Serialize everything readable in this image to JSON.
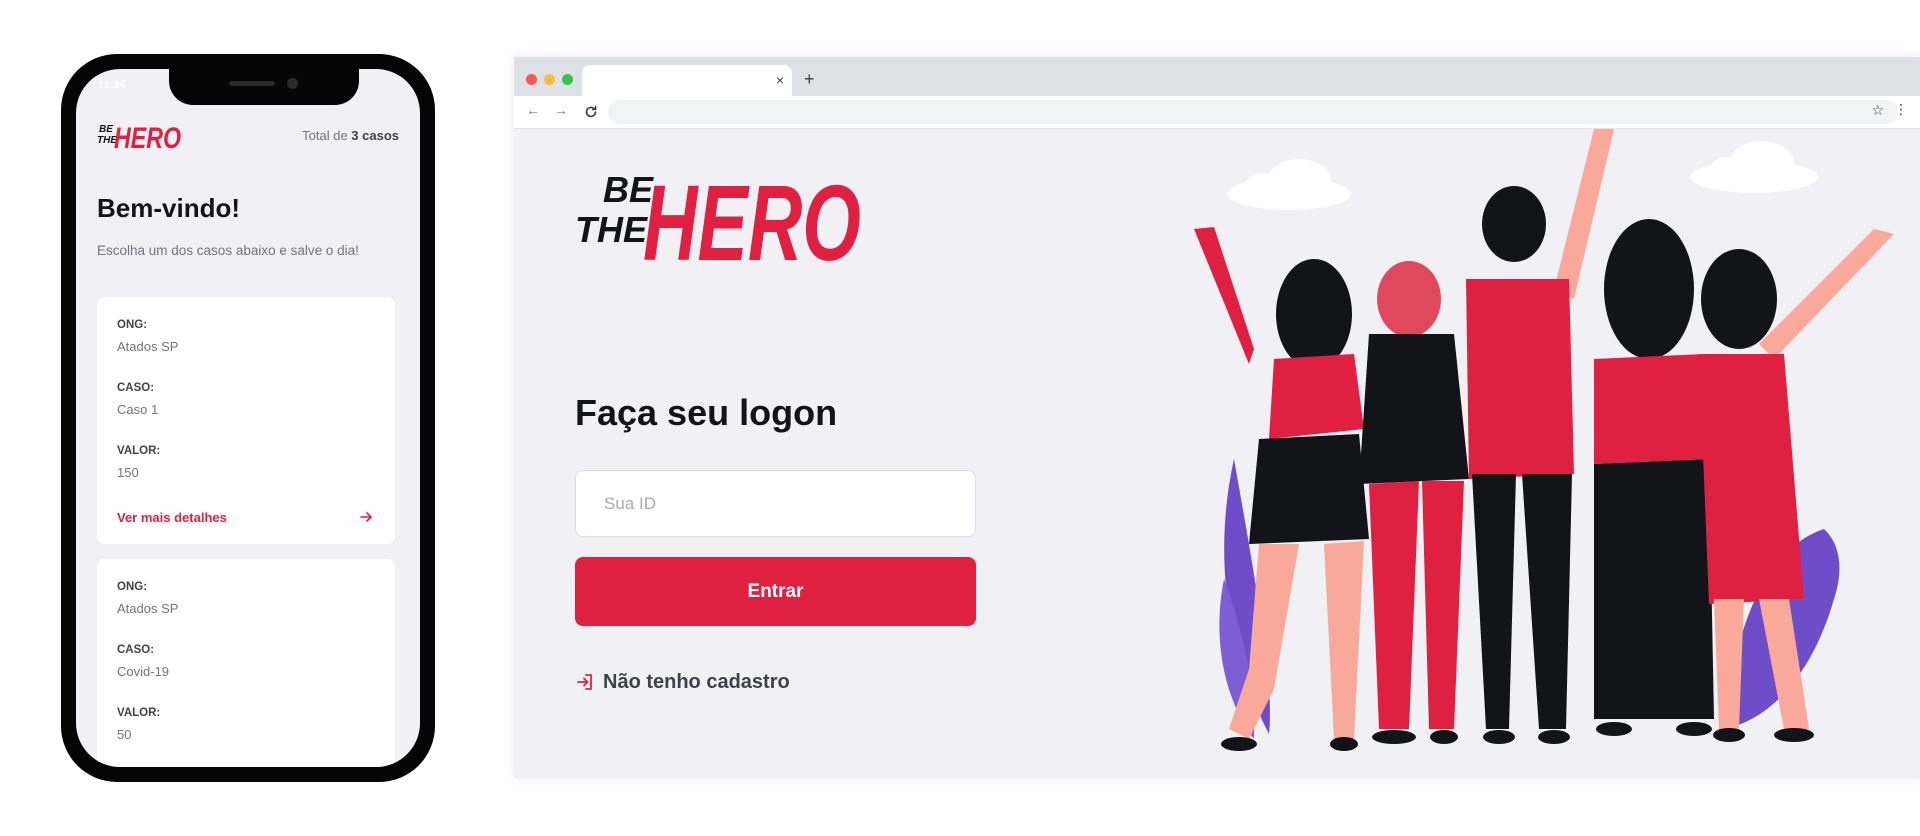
{
  "colors": {
    "brand_red": "#e02041",
    "background": "#f0f0f5",
    "dark_text": "#13131a",
    "muted_text": "#737380",
    "purple": "#6f4dc9"
  },
  "logo": {
    "line1": "BE",
    "line2": "THE",
    "word": "HERO"
  },
  "mobile": {
    "status_time": "11:34",
    "total_prefix": "Total de ",
    "total_count": "3 casos",
    "title": "Bem-vindo!",
    "subtitle": "Escolha um dos casos abaixo e salve o dia!",
    "labels": {
      "ong": "ONG:",
      "caso": "CASO:",
      "valor": "VALOR:"
    },
    "link_label": "Ver mais detalhes",
    "cases": [
      {
        "ong": "Atados SP",
        "caso": "Caso 1",
        "valor": "150"
      },
      {
        "ong": "Atados SP",
        "caso": "Covid-19",
        "valor": "50"
      }
    ]
  },
  "browser": {
    "tab_title": "",
    "tab_close": "×",
    "new_tab": "+",
    "nav": {
      "back": "←",
      "forward": "→",
      "reload": "C",
      "star": "☆",
      "menu": "⋮"
    },
    "url": ""
  },
  "login": {
    "title": "Faça seu logon",
    "input_placeholder": "Sua ID",
    "input_value": "",
    "button_label": "Entrar",
    "register_label": "Não tenho cadastro",
    "register_icon": "log-in-icon"
  },
  "illustration": "heroes-group-icon"
}
